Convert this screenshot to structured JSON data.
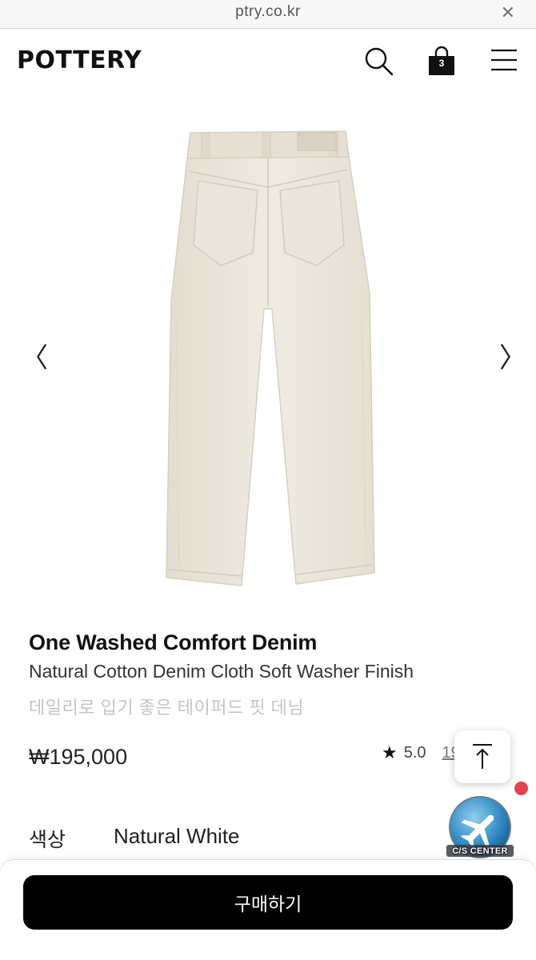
{
  "browser": {
    "url": "ptry.co.kr"
  },
  "header": {
    "logo": "POTTERY",
    "cart_count": "3",
    "icons": [
      "search-icon",
      "shopping-bag-icon",
      "hamburger-menu-icon"
    ]
  },
  "gallery": {
    "image": "beige-denim-pants-back-view",
    "prev_arrow": "〈",
    "next_arrow": "〉"
  },
  "product": {
    "name": "One Washed Comfort Denim",
    "subtitle": "Natural Cotton Denim Cloth Soft Washer Finish",
    "description": "데일리로 입기 좋은 테이퍼드 핏 데님",
    "price": "₩195,000",
    "rating": "5.0",
    "review_count": "19"
  },
  "option": {
    "label": "색상",
    "value": "Natural White"
  },
  "floating": {
    "cs_label": "C/S CENTER"
  },
  "buy_bar": {
    "buy_label": "구매하기"
  },
  "colors": {
    "pants": "#ece7dc",
    "accent_dot": "#e8424b",
    "button_bg": "#000000"
  }
}
